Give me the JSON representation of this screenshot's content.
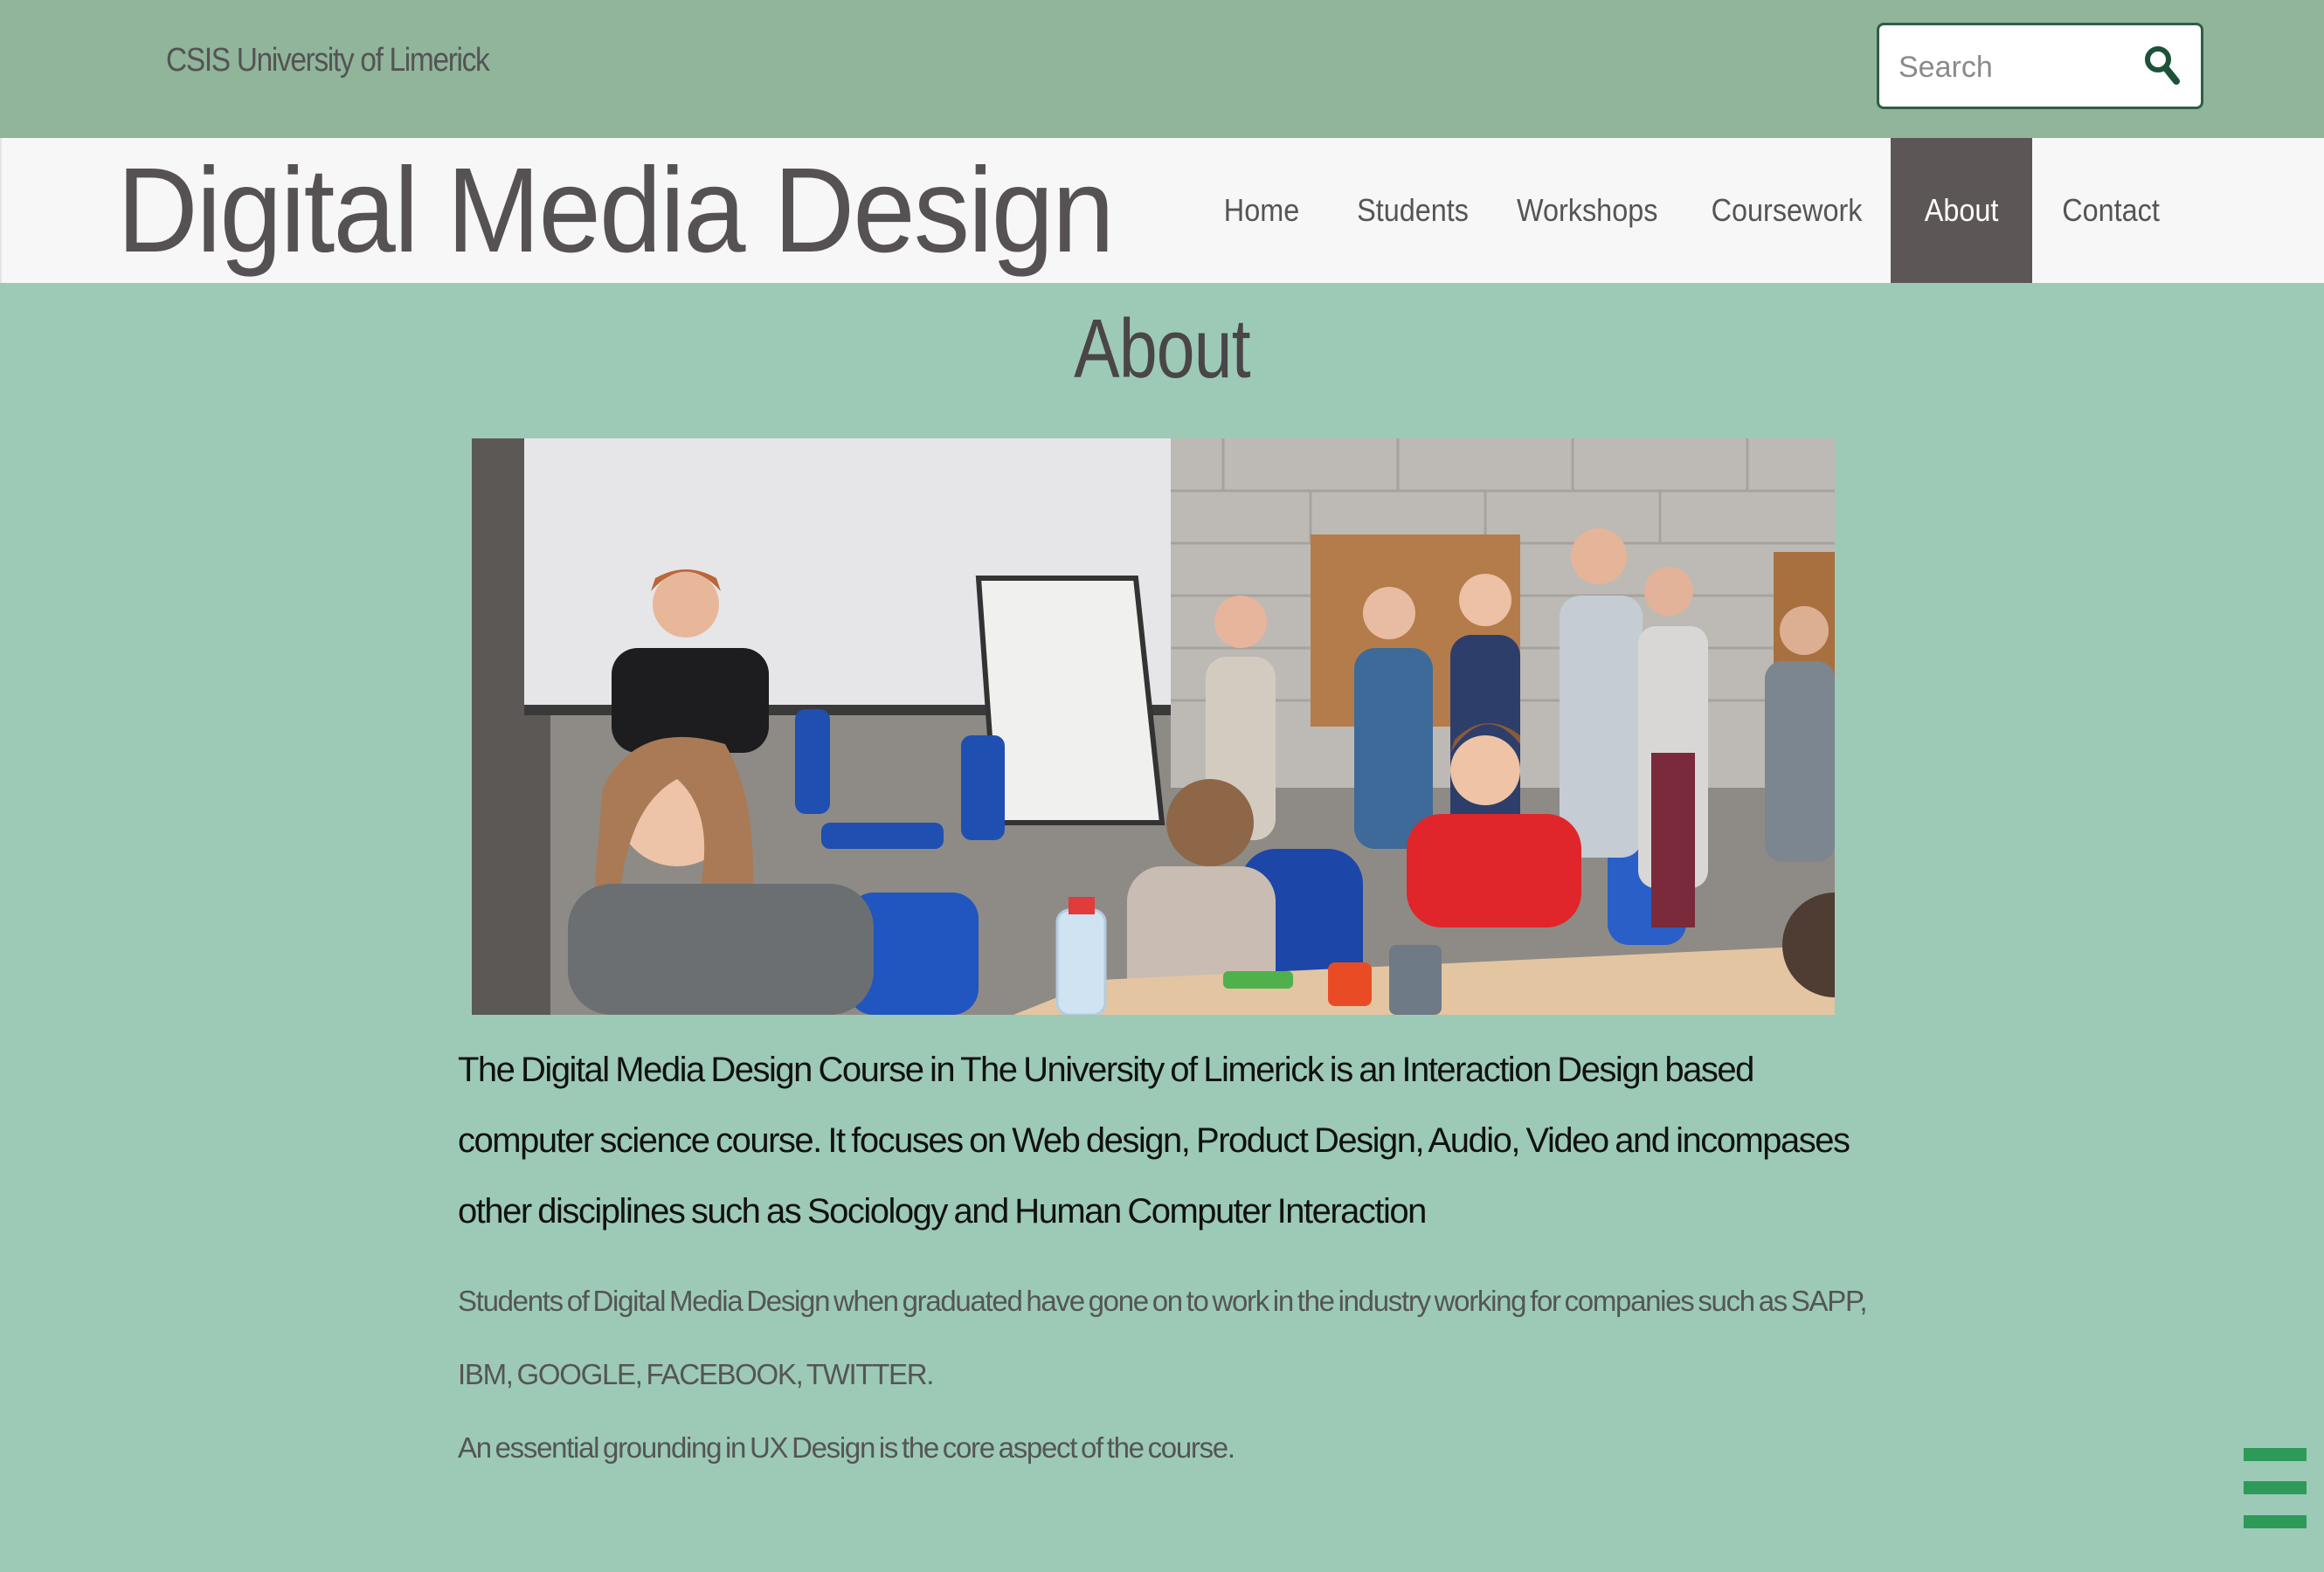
{
  "topbar": {
    "org_name": "CSIS University of Limerick",
    "search": {
      "placeholder": "Search",
      "icon": "search-icon"
    }
  },
  "header": {
    "site_title": "Digital Media Design",
    "nav": [
      {
        "label": "Home",
        "active": false
      },
      {
        "label": "Students",
        "active": false
      },
      {
        "label": "Workshops",
        "active": false
      },
      {
        "label": "Coursework",
        "active": false
      },
      {
        "label": "About",
        "active": true
      },
      {
        "label": "Contact",
        "active": false
      }
    ]
  },
  "main": {
    "heading": "About",
    "lead": "The Digital Media Design Course in The University of Limerick is an Interaction Design based computer science course. It focuses on Web design, Product Design, Audio, Video and incompases other disciplines such as Sociology and Human Computer Interaction",
    "paragraphs": [
      "Students of Digital Media Design when graduated have gone on to work in the industry working for companies such as SAPP, IBM, GOOGLE, FACEBOOK, TWITTER.",
      "An essential grounding in UX Design is the core aspect of the course."
    ]
  },
  "menu_toggle": {
    "icon": "hamburger-menu-icon"
  },
  "colors": {
    "topbar_bg": "#90b59b",
    "page_bg": "#9ccab7",
    "header_bg": "#f7f7f7",
    "nav_active_bg": "#5c5657",
    "menu_icon": "#2e9a5a"
  }
}
